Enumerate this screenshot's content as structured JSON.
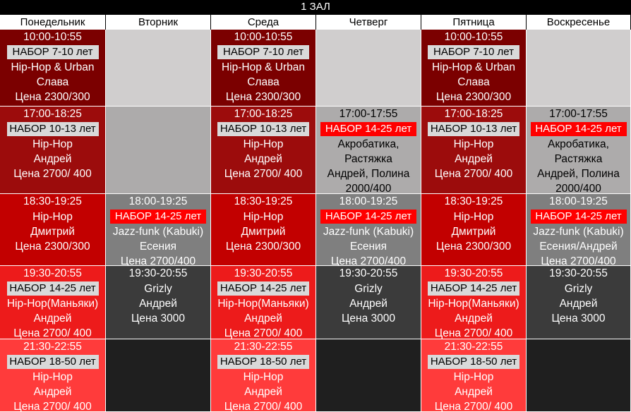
{
  "title": "1 ЗАЛ",
  "days": [
    "Понедельник",
    "Вторник",
    "Среда",
    "Четверг",
    "Пятница",
    "Воскресенье"
  ],
  "colors": {
    "row1": "#7b0000",
    "row2": "#9c0c0c",
    "row3": "#c20000",
    "row4": "#ed1b1b",
    "row5": "#ff3b3b",
    "empty_light": "#d0cece",
    "empty_mid": "#adabab",
    "grey_mid": "#7f7f7f",
    "grey_dark": "#3b3b3b",
    "empty_dark": "#1f1f1f",
    "badge_light": "#d9d9d9",
    "badge_red": "#ff0000"
  },
  "rows": [
    {
      "slots": [
        {
          "time": "10:00-10:55",
          "badge": "НАБОР 7-10 лет",
          "lines": [
            "Hip-Hop & Urban",
            "Слава",
            "Цена 2300/300"
          ]
        },
        null,
        {
          "time": "10:00-10:55",
          "badge": "НАБОР 7-10 лет",
          "lines": [
            "Hip-Hop & Urban",
            "Слава",
            "Цена 2300/300"
          ]
        },
        null,
        {
          "time": "10:00-10:55",
          "badge": "НАБОР 7-10 лет",
          "lines": [
            "Hip-Hop & Urban",
            "Слава",
            "Цена 2300/300"
          ]
        },
        null
      ]
    },
    {
      "slots": [
        {
          "time": "17:00-18:25",
          "badge": "НАБОР 10-13 лет",
          "lines": [
            "Hip-Hop",
            "Андрей",
            "Цена 2700/ 400"
          ]
        },
        null,
        {
          "time": "17:00-18:25",
          "badge": "НАБОР 10-13 лет",
          "lines": [
            "Hip-Hop",
            "Андрей",
            "Цена 2700/ 400"
          ]
        },
        {
          "time": "17:00-17:55",
          "badge": "НАБОР 14-25 лет",
          "lines": [
            "Акробатика,",
            "Растяжка",
            "Андрей, Полина",
            "2000/400"
          ]
        },
        {
          "time": "17:00-18:25",
          "badge": "НАБОР 10-13 лет",
          "lines": [
            "Hip-Hop",
            "Андрей",
            "Цена 2700/ 400"
          ]
        },
        {
          "time": "17:00-17:55",
          "badge": "НАБОР 14-25 лет",
          "lines": [
            "Акробатика,",
            "Растяжка",
            "Андрей, Полина",
            "2000/400"
          ]
        }
      ]
    },
    {
      "slots": [
        {
          "time": "18:30-19:25",
          "badge": null,
          "lines": [
            "Hip-Hop",
            "Дмитрий",
            "Цена 2300/300"
          ]
        },
        {
          "time": "18:00-19:25",
          "badge": "НАБОР 14-25 лет",
          "lines": [
            "Jazz-funk (Kabuki)",
            "Есения",
            "Цена 2700/400"
          ]
        },
        {
          "time": "18:30-19:25",
          "badge": null,
          "lines": [
            "Hip-Hop",
            "Дмитрий",
            "Цена 2300/300"
          ]
        },
        {
          "time": "18:00-19:25",
          "badge": "НАБОР 14-25 лет",
          "lines": [
            "Jazz-funk (Kabuki)",
            "Есения",
            "Цена 2700/400"
          ]
        },
        {
          "time": "18:30-19:25",
          "badge": null,
          "lines": [
            "Hip-Hop",
            "Дмитрий",
            "Цена 2300/300"
          ]
        },
        {
          "time": "18:00-19:25",
          "badge": "НАБОР 14-25 лет",
          "lines": [
            "Jazz-funk (Kabuki)",
            "Есения/Андрей",
            "Цена 2700/400"
          ]
        }
      ]
    },
    {
      "slots": [
        {
          "time": "19:30-20:55",
          "badge": "НАБОР 14-25 лет",
          "lines": [
            "Hip-Hop(Маньяки)",
            "Андрей",
            "Цена 2700/ 400"
          ]
        },
        {
          "time": "19:30-20:55",
          "badge": null,
          "lines": [
            "Grizly",
            "Андрей",
            "Цена 3000"
          ]
        },
        {
          "time": "19:30-20:55",
          "badge": "НАБОР 14-25 лет",
          "lines": [
            "Hip-Hop(Маньяки)",
            "Андрей",
            "Цена 2700/ 400"
          ]
        },
        {
          "time": "19:30-20:55",
          "badge": null,
          "lines": [
            "Grizly",
            "Андрей",
            "Цена 3000"
          ]
        },
        {
          "time": "19:30-20:55",
          "badge": "НАБОР 14-25 лет",
          "lines": [
            "Hip-Hop(Маньяки)",
            "Андрей",
            "Цена 2700/ 400"
          ]
        },
        {
          "time": "19:30-20:55",
          "badge": null,
          "lines": [
            "Grizly",
            "Андрей",
            "Цена 3000"
          ]
        }
      ]
    },
    {
      "slots": [
        {
          "time": "21:30-22:55",
          "badge": "НАБОР 18-50 лет",
          "lines": [
            "Hip-Hop",
            "Андрей",
            "Цена 2700/ 400"
          ]
        },
        null,
        {
          "time": "21:30-22:55",
          "badge": "НАБОР 18-50 лет",
          "lines": [
            "Hip-Hop",
            "Андрей",
            "Цена 2700/ 400"
          ]
        },
        null,
        {
          "time": "21:30-22:55",
          "badge": "НАБОР 18-50 лет",
          "lines": [
            "Hip-Hop",
            "Андрей",
            "Цена 2700/ 400"
          ]
        },
        null
      ]
    }
  ]
}
